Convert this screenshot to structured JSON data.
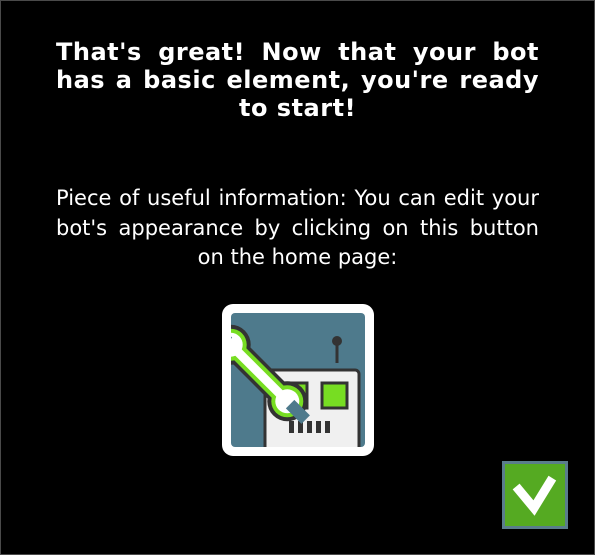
{
  "dialog": {
    "headline": "That's great! Now that your bot has a basic element, you're ready to start!",
    "info": "Piece of useful information: You can edit your bot's appearance by clicking on this button on the home page:"
  },
  "icons": {
    "edit_bot": "bot-customize-icon",
    "confirm": "checkmark-icon"
  },
  "colors": {
    "background": "#000000",
    "text": "#ffffff",
    "icon_tile": "#4e7a8c",
    "accent_green": "#55aa22",
    "robot_eye": "#77dd22",
    "robot_body": "#eeeeee"
  }
}
